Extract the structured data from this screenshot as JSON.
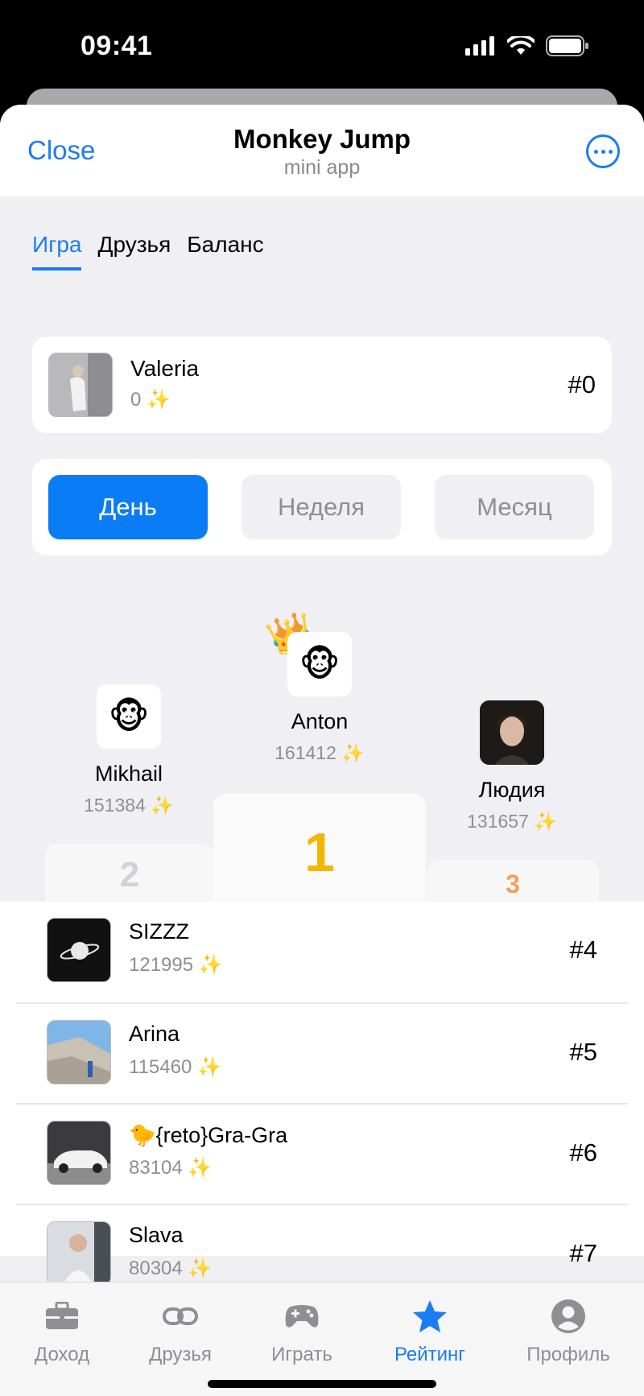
{
  "status": {
    "time": "09:41"
  },
  "header": {
    "close": "Close",
    "title": "Monkey Jump",
    "subtitle": "mini app"
  },
  "tabs": [
    {
      "label": "Игра"
    },
    {
      "label": "Друзья"
    },
    {
      "label": "Баланс"
    }
  ],
  "me": {
    "name": "Valeria",
    "score": "0 ✨",
    "rank": "#0"
  },
  "periods": [
    {
      "label": "День"
    },
    {
      "label": "Неделя"
    },
    {
      "label": "Месяц"
    }
  ],
  "podium": [
    {
      "place": "1",
      "name": "Anton",
      "score": "161412 ✨",
      "avatar": "🐵"
    },
    {
      "place": "2",
      "name": "Mikhail",
      "score": "151384 ✨",
      "avatar": "🐵"
    },
    {
      "place": "3",
      "name": "Людия",
      "score": "131657 ✨",
      "avatar": "photo"
    }
  ],
  "leaders": [
    {
      "name": "SIZZZ",
      "score": "121995 ✨",
      "rank": "#4"
    },
    {
      "name": "Arina",
      "score": "115460 ✨",
      "rank": "#5"
    },
    {
      "name": "🐤{reto}Gra-Gra",
      "score": "83104 ✨",
      "rank": "#6"
    },
    {
      "name": "Slava",
      "score": "80304 ✨",
      "rank": "#7"
    }
  ],
  "tabbar": [
    {
      "label": "Доход",
      "icon": "briefcase-icon"
    },
    {
      "label": "Друзья",
      "icon": "link-icon"
    },
    {
      "label": "Играть",
      "icon": "gamepad-icon"
    },
    {
      "label": "Рейтинг",
      "icon": "star-icon"
    },
    {
      "label": "Профиль",
      "icon": "profile-icon"
    }
  ],
  "colors": {
    "accent": "#1a7df2",
    "gold": "#f2b705",
    "bronze": "#f2a05a",
    "silver": "#d1d1d6"
  }
}
